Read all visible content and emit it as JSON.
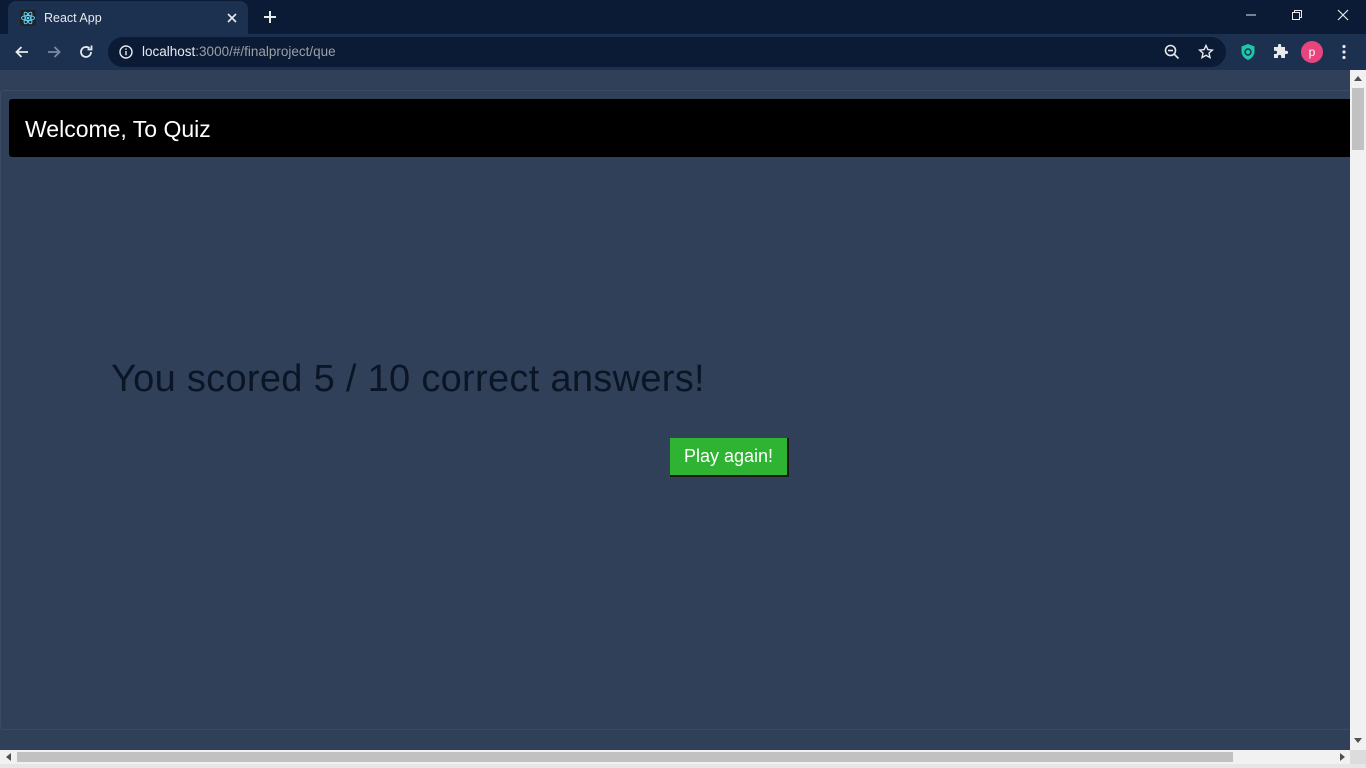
{
  "browser": {
    "tab_title": "React App",
    "url_host": "localhost",
    "url_rest": ":3000/#/finalproject/que",
    "profile_initial": "p",
    "icons": {
      "favicon": "react-icon",
      "close": "close-icon",
      "new_tab": "plus-icon",
      "back": "arrow-left-icon",
      "forward": "arrow-right-icon",
      "reload": "reload-icon",
      "info": "info-icon",
      "zoom": "zoom-out-icon",
      "bookmark": "star-icon",
      "extension_shield": "shield-icon",
      "extensions": "puzzle-icon",
      "menu": "kebab-menu-icon"
    },
    "colors": {
      "titlebar": "#0b1a35",
      "toolbar": "#1c3050",
      "profile": "#e8457f",
      "shield": "#1bc9a9"
    }
  },
  "page": {
    "header_title": "Welcome, To Quiz",
    "score_text": "You scored 5 / 10 correct answers!",
    "play_again_label": "Play again!",
    "colors": {
      "background": "#2f4058",
      "header": "#000000",
      "button": "#2eb432",
      "score_text": "#0b1525"
    }
  }
}
